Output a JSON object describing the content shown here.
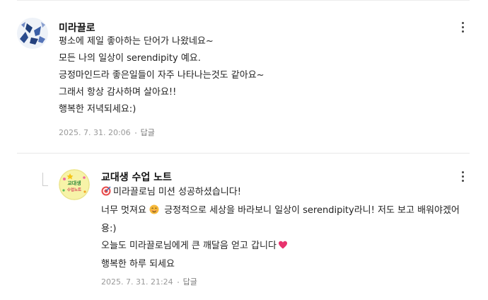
{
  "comments": [
    {
      "author": "미라끌로",
      "lines": [
        "평소에 제일 좋아하는 단어가 나왔네요~",
        "모든 나의 일상이 serendipity 예요.",
        "긍정마인드라 좋은일들이 자주 나타나는것도 같아요~",
        "그래서 항상 감사하며 살아요!!",
        "행복한 저녁되세요:)"
      ],
      "date": "2025. 7. 31. 20:06",
      "reply_label": "답글"
    },
    {
      "author": "교대생 수업 노트",
      "avatar_text": [
        "교대생",
        "수업노트"
      ],
      "line1": "미라끌로님 미션 성공하셨습니다!",
      "line2a": "너무 멋져요",
      "line2b": " 긍정적으로 세상을 바라보니 일상이 serendipity라니! 저도 보고 배워야겠어용:)",
      "line3": "오늘도 미라끌로님에게 큰 깨달음 얻고 갑니다",
      "line4": "행복한 하루 되세요",
      "date": "2025. 7. 31. 21:24",
      "reply_label": "답글"
    }
  ],
  "colors": {
    "text": "#222222",
    "meta": "#999999",
    "heart": "#e8336d",
    "target": "#e84a4a"
  }
}
